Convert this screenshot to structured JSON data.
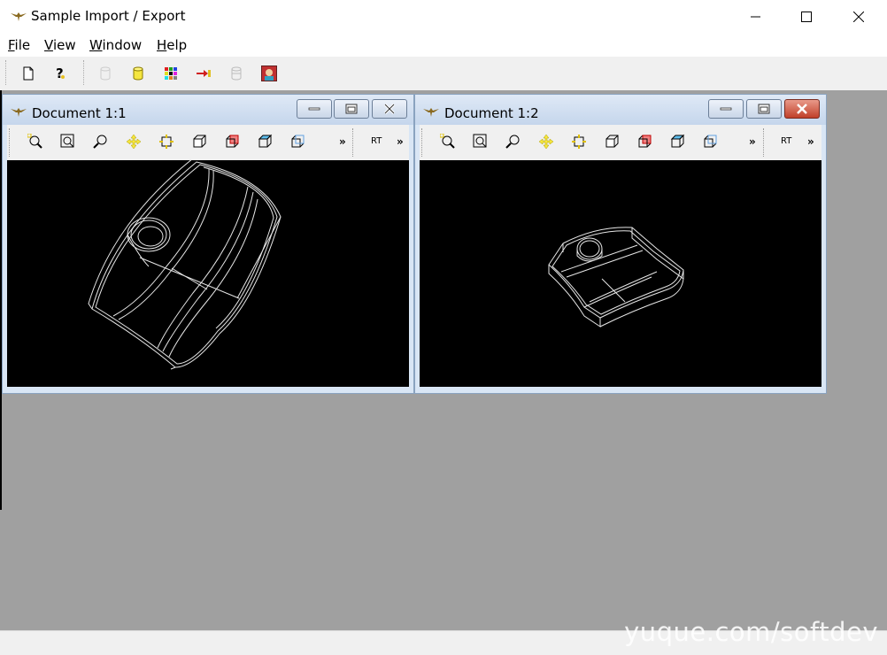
{
  "window": {
    "title": "Sample Import / Export"
  },
  "menu": {
    "items": [
      "File",
      "View",
      "Window",
      "Help"
    ]
  },
  "toolbar": {
    "buttons": [
      "new-document",
      "help",
      "erase-disabled",
      "cylinder",
      "color-palette",
      "import-export",
      "shading-disabled",
      "image"
    ]
  },
  "documents": [
    {
      "title": "Document 1:1",
      "rt_label": "RT",
      "more_label": "»",
      "active": false
    },
    {
      "title": "Document 1:2",
      "rt_label": "RT",
      "more_label": "»",
      "active": true
    }
  ],
  "view_toolbar": {
    "buttons": [
      "zoom-window",
      "zoom-fit-all",
      "zoom",
      "pan",
      "global-pan",
      "front-view",
      "back-view",
      "top-view",
      "axonometric-view"
    ]
  },
  "watermark": "yuque.com/softdev",
  "colors": {
    "mdi_background": "#a0a0a0",
    "viewport": "#000000",
    "wireframe": "#e6e6e6"
  }
}
